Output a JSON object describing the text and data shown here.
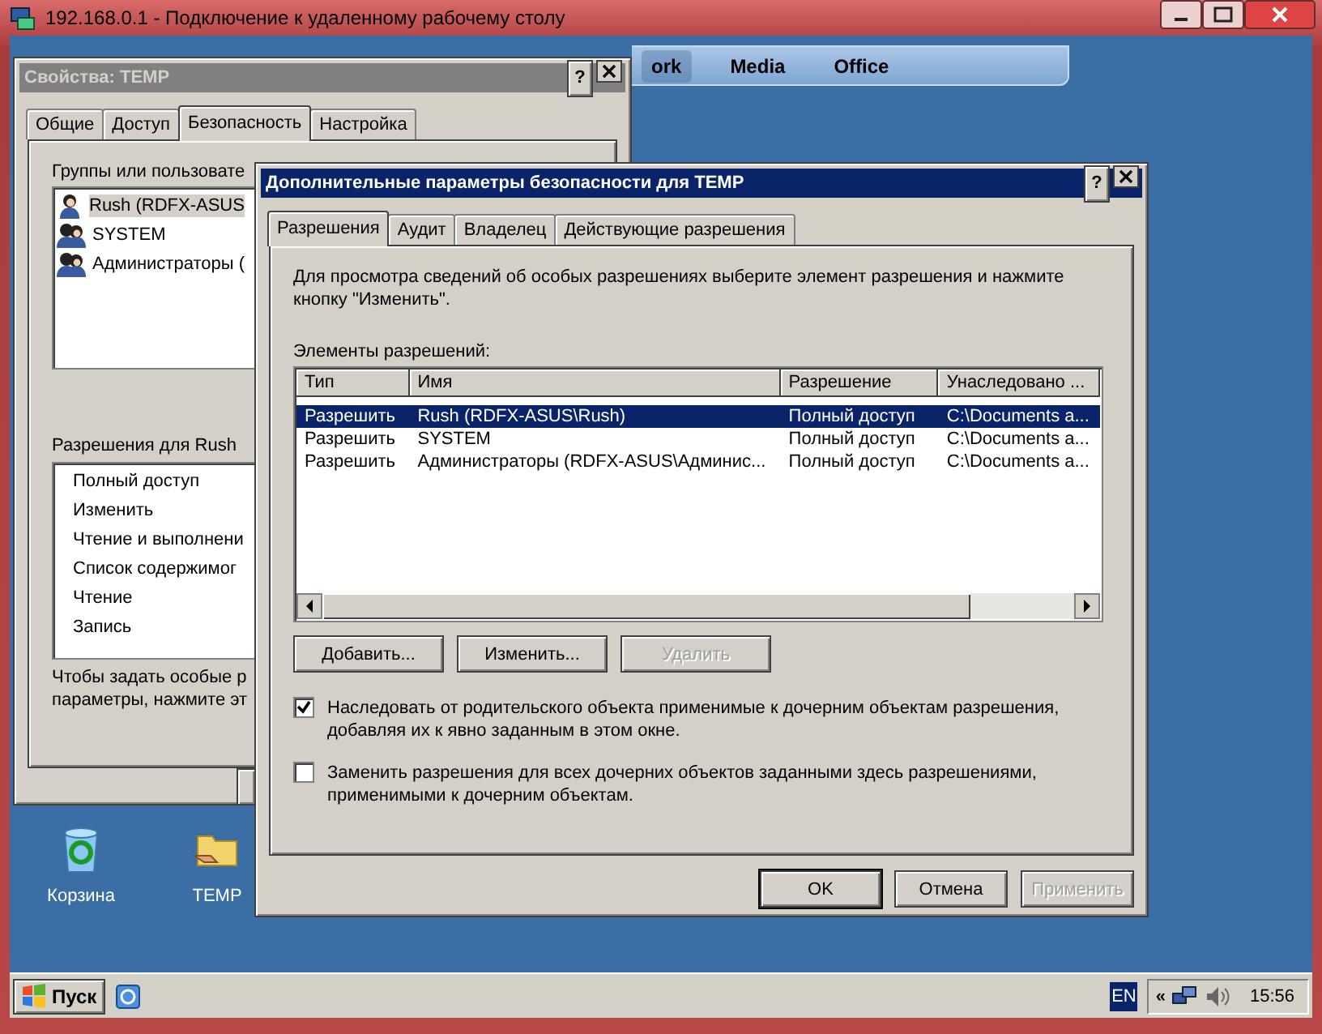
{
  "rdp_window": {
    "title": "192.168.0.1 - Подключение к удаленному рабочему столу"
  },
  "desktop_toolbar": {
    "items": [
      {
        "label": "ork",
        "selected": true
      },
      {
        "label": "Media",
        "selected": false
      },
      {
        "label": "Office",
        "selected": false
      }
    ]
  },
  "properties_window": {
    "title": "Свойства: TEMP",
    "help_button": "?",
    "active": false,
    "tabs": [
      {
        "label": "Общие",
        "selected": false
      },
      {
        "label": "Доступ",
        "selected": false
      },
      {
        "label": "Безопасность",
        "selected": true
      },
      {
        "label": "Настройка",
        "selected": false
      }
    ],
    "groups_label": "Группы или пользовате",
    "groups": [
      {
        "name": "Rush (RDFX-ASUS",
        "kind": "user",
        "selected": true
      },
      {
        "name": "SYSTEM",
        "kind": "group",
        "selected": false
      },
      {
        "name": "Администраторы (",
        "kind": "group",
        "selected": false
      }
    ],
    "permissions_label": "Разрешения для Rush",
    "permissions": [
      "Полный доступ",
      "Изменить",
      "Чтение и выполнени",
      "Список содержимог",
      "Чтение",
      "Запись"
    ],
    "note_lines": [
      "Чтобы задать особые р",
      "параметры, нажмите эт"
    ]
  },
  "advanced_dialog": {
    "title": "Дополнительные параметры безопасности для TEMP",
    "help_button": "?",
    "active": true,
    "tabs": [
      {
        "label": "Разрешения",
        "selected": true
      },
      {
        "label": "Аудит",
        "selected": false
      },
      {
        "label": "Владелец",
        "selected": false
      },
      {
        "label": "Действующие разрешения",
        "selected": false
      }
    ],
    "description": "Для просмотра сведений об особых разрешениях выберите элемент разрешения и нажмите кнопку \"Изменить\".",
    "list_label": "Элементы разрешений:",
    "columns": [
      "Тип",
      "Имя",
      "Разрешение",
      "Унаследовано ..."
    ],
    "rows": [
      {
        "cells": [
          "Разрешить",
          "Rush (RDFX-ASUS\\Rush)",
          "Полный доступ",
          "C:\\Documents a..."
        ],
        "selected": true
      },
      {
        "cells": [
          "Разрешить",
          "SYSTEM",
          "Полный доступ",
          "C:\\Documents a..."
        ],
        "selected": false
      },
      {
        "cells": [
          "Разрешить",
          "Администраторы (RDFX-ASUS\\Админис...",
          "Полный доступ",
          "C:\\Documents a..."
        ],
        "selected": false
      }
    ],
    "buttons": [
      {
        "label": "Добавить...",
        "disabled": false
      },
      {
        "label": "Изменить...",
        "disabled": false
      },
      {
        "label": "Удалить",
        "disabled": true
      }
    ],
    "options": [
      {
        "label": "Наследовать от родительского объекта применимые к дочерним объектам разрешения, добавляя их к явно заданным в этом окне.",
        "checked": true
      },
      {
        "label": "Заменить разрешения для всех дочерних объектов заданными здесь разрешениями, применимыми к дочерним объектам.",
        "checked": false
      }
    ],
    "dialog_buttons": [
      {
        "label": "OK",
        "disabled": false,
        "default": true
      },
      {
        "label": "Отмена",
        "disabled": false,
        "default": false
      },
      {
        "label": "Применить",
        "disabled": true,
        "default": false
      }
    ]
  },
  "desktop_icons": [
    {
      "label": "Корзина",
      "kind": "recycle-bin"
    },
    {
      "label": "TEMP",
      "kind": "folder"
    }
  ],
  "taskbar": {
    "start_label": "Пуск",
    "language": "EN",
    "tray_toggle": "«",
    "clock": "15:56"
  }
}
